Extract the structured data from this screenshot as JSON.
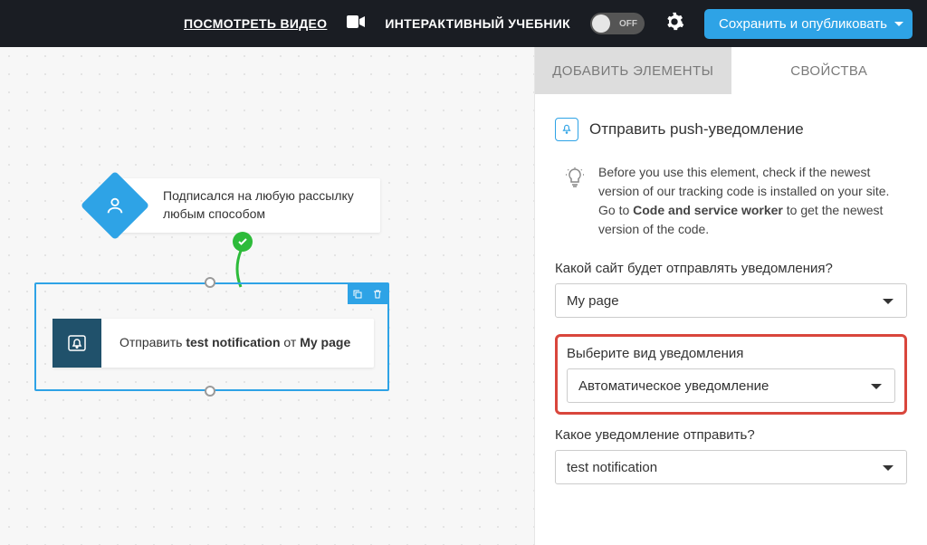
{
  "header": {
    "video_link": "ПОСМОТРЕТЬ ВИДЕО",
    "tutorial_label": "ИНТЕРАКТИВНЫЙ УЧЕБНИК",
    "toggle_state": "OFF",
    "save_button": "Сохранить и опубликовать"
  },
  "canvas": {
    "trigger_line1": "Подписался на любую рассылку",
    "trigger_line2": "любым способом",
    "action_prefix": "Отправить ",
    "action_item": "test notification",
    "action_mid": " от ",
    "action_source": "My page"
  },
  "panel": {
    "tab_add": "ДОБАВИТЬ ЭЛЕМЕНТЫ",
    "tab_props": "СВОЙСТВА",
    "title": "Отправить push-уведомление",
    "notice_pre": "Before you use this element, check if the newest version of our tracking code is installed on your site. Go to ",
    "notice_bold": "Code and service worker",
    "notice_post": " to get the newest version of the code.",
    "site_label": "Какой сайт будет отправлять уведомления?",
    "site_value": "My page",
    "type_label": "Выберите вид уведомления",
    "type_value": "Автоматическое уведомление",
    "notif_label": "Какое уведомление отправить?",
    "notif_value": "test notification"
  }
}
